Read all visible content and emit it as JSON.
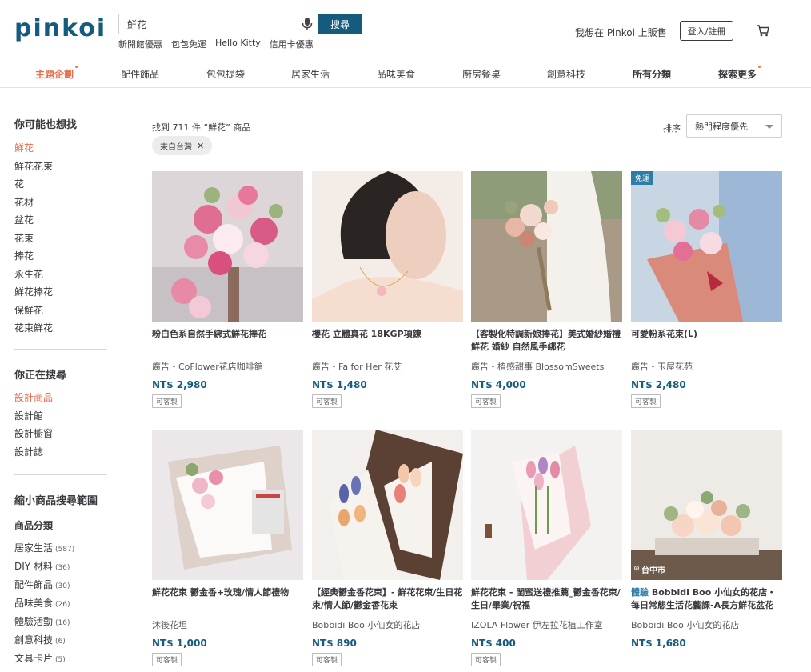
{
  "brand": {
    "logo": "pinkoi",
    "color": "#155b7d",
    "accent": "#e96d4c"
  },
  "search": {
    "query": "鮮花",
    "button": "搜尋",
    "quick_links": [
      "新開館優惠",
      "包包免運",
      "Hello Kitty",
      "信用卡優惠"
    ]
  },
  "header": {
    "sell": "我想在 Pinkoi 上販售",
    "login": "登入/註冊"
  },
  "nav": [
    "主題企劃",
    "配件飾品",
    "包包提袋",
    "居家生活",
    "品味美食",
    "廚房餐桌",
    "創意科技",
    "所有分類",
    "探索更多"
  ],
  "sidebar": {
    "related_title": "你可能也想找",
    "related": [
      "鮮花",
      "鮮花花束",
      "花",
      "花材",
      "盆花",
      "花束",
      "捧花",
      "永生花",
      "鮮花捧花",
      "保鮮花",
      "花束鮮花"
    ],
    "searching_title": "你正在搜尋",
    "searching": [
      "設計商品",
      "設計館",
      "設計櫥窗",
      "設計誌"
    ],
    "narrow_title": "縮小商品搜尋範圍",
    "category_title": "商品分類",
    "categories": [
      {
        "name": "居家生活",
        "count": "(587)"
      },
      {
        "name": "DIY 材料",
        "count": "(36)"
      },
      {
        "name": "配件飾品",
        "count": "(30)"
      },
      {
        "name": "品味美食",
        "count": "(26)"
      },
      {
        "name": "體驗活動",
        "count": "(16)"
      },
      {
        "name": "創意科技",
        "count": "(6)"
      },
      {
        "name": "文具卡片",
        "count": "(5)"
      }
    ]
  },
  "results": {
    "count_text": "找到 711 件 “鮮花” 商品",
    "filter": "來自台灣",
    "sort_label": "排序",
    "sort_value": "熱門程度優先"
  },
  "products": [
    {
      "name": "粉白色系自然手綁式鮮花捧花",
      "shop": "廣告・CoFlower花店咖啡館",
      "price": "NT$ 2,980",
      "tag": "可客製"
    },
    {
      "name": "櫻花 立體真花 18KGP項鍊",
      "shop": "廣告・Fa for Her 花艾",
      "price": "NT$ 1,480",
      "tag": "可客製"
    },
    {
      "name": "【客製化特調新娘捧花】美式婚紗婚禮 鮮花 婚紗 自然風手綁花",
      "shop": "廣告・植感甜事 BlossomSweets",
      "price": "NT$ 4,000",
      "tag": "可客製"
    },
    {
      "name": "可愛粉系花束(L)",
      "shop": "廣告・玉屋花苑",
      "price": "NT$ 2,480",
      "tag": "可客製",
      "badge": "免運"
    },
    {
      "name": "鮮花花束 鬱金香+玫瑰/情人節禮物",
      "shop": "沐後花坦",
      "price": "NT$ 1,000",
      "tag": "可客製"
    },
    {
      "name": "【經典鬱金香花束】- 鮮花花束/生日花束/情人節/鬱金香花束",
      "shop": "Bobbidi Boo 小仙女的花店",
      "price": "NT$ 890",
      "tag": "可客製"
    },
    {
      "name": "鮮花花束 - 閨蜜送禮推薦_鬱金香花束/生日/畢業/祝福",
      "shop": "IZOLA Flower 伊左拉花植工作室",
      "price": "NT$ 400",
      "tag": "可客製"
    },
    {
      "name": "Bobbidi Boo 小仙女的花店・每日常態生活花藝課-A長方鮮花盆花",
      "exp_tag": "體驗",
      "shop": "Bobbidi Boo 小仙女的花店",
      "price": "NT$ 1,680",
      "location": "台中市"
    }
  ]
}
